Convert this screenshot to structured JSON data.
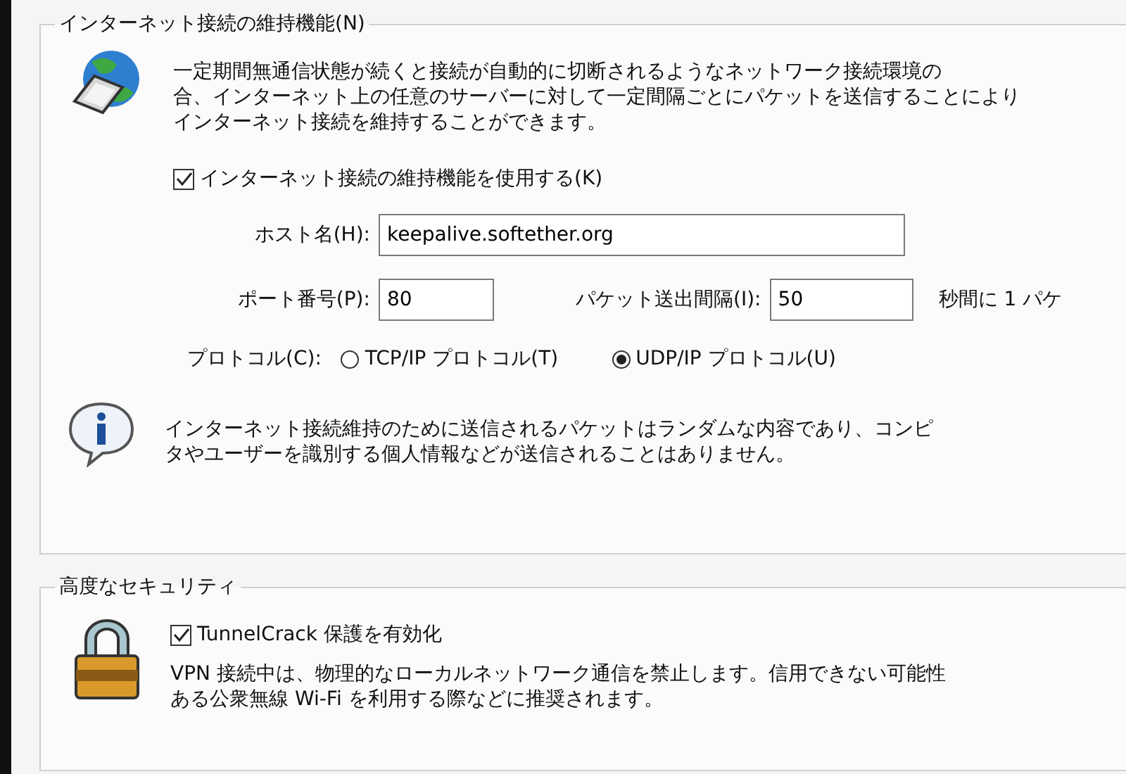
{
  "keepalive": {
    "title": "インターネット接続の維持機能(N)",
    "description_lines": [
      "一定期間無通信状態が続くと接続が自動的に切断されるようなネットワーク接続環境の",
      "合、インターネット上の任意のサーバーに対して一定間隔ごとにパケットを送信することにより",
      "インターネット接続を維持することができます。"
    ],
    "enable": {
      "label": "インターネット接続の維持機能を使用する(K)",
      "checked": true
    },
    "host": {
      "label": "ホスト名(H):",
      "value": "keepalive.softether.org"
    },
    "port": {
      "label": "ポート番号(P):",
      "value": "80"
    },
    "interval": {
      "label": "パケット送出間隔(I):",
      "value": "50",
      "unit": "秒間に 1 パケ"
    },
    "protocol": {
      "label": "プロトコル(C):",
      "options": [
        {
          "label": "TCP/IP プロトコル(T)",
          "selected": false
        },
        {
          "label": "UDP/IP プロトコル(U)",
          "selected": true
        }
      ]
    },
    "note_lines": [
      "インターネット接続維持のために送信されるパケットはランダムな内容であり、コンピ",
      "タやユーザーを識別する個人情報などが送信されることはありません。"
    ]
  },
  "security": {
    "title": "高度なセキュリティ",
    "tunnelcrack": {
      "label": "TunnelCrack 保護を有効化",
      "checked": true
    },
    "description_lines": [
      "VPN 接続中は、物理的なローカルネットワーク通信を禁止します。信用できない可能性",
      "ある公衆無線 Wi-Fi を利用する際などに推奨されます。"
    ]
  }
}
